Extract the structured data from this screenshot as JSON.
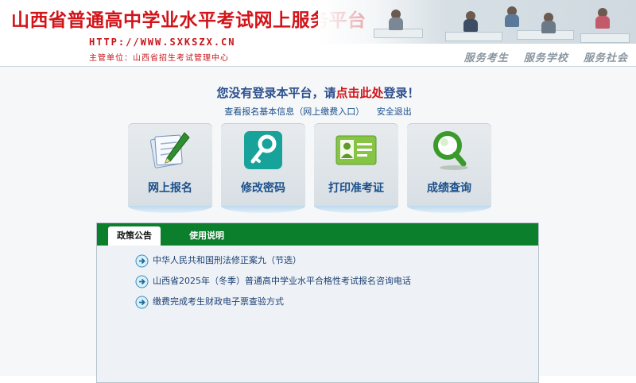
{
  "header": {
    "title": "山西省普通高中学业水平考试网上服务平台",
    "url": "HTTP://WWW.SXKSZX.CN",
    "sponsor": "主管单位：山西省招生考试管理中心",
    "slogans": [
      "服务考生",
      "服务学校",
      "服务社会"
    ]
  },
  "login": {
    "prefix": "您没有登录本平台，请",
    "link": "点击此处",
    "suffix": "登录！"
  },
  "links": {
    "view_info": "查看报名基本信息（网上缴费入口）",
    "logout": "安全退出"
  },
  "tiles": [
    {
      "label": "网上报名",
      "icon": "notepad-pen-icon"
    },
    {
      "label": "修改密码",
      "icon": "key-icon"
    },
    {
      "label": "打印准考证",
      "icon": "id-card-icon"
    },
    {
      "label": "成绩查询",
      "icon": "magnifier-icon"
    }
  ],
  "tabs": [
    "政策公告",
    "使用说明"
  ],
  "announcements": [
    "中华人民共和国刑法修正案九（节选）",
    "山西省2025年（冬季）普通高中学业水平合格性考试报名咨询电话",
    "缴费完成考生财政电子票查验方式"
  ],
  "colors": {
    "title_red": "#d2141a",
    "link_blue": "#1b4f8a",
    "tab_green": "#0b7f2c"
  }
}
